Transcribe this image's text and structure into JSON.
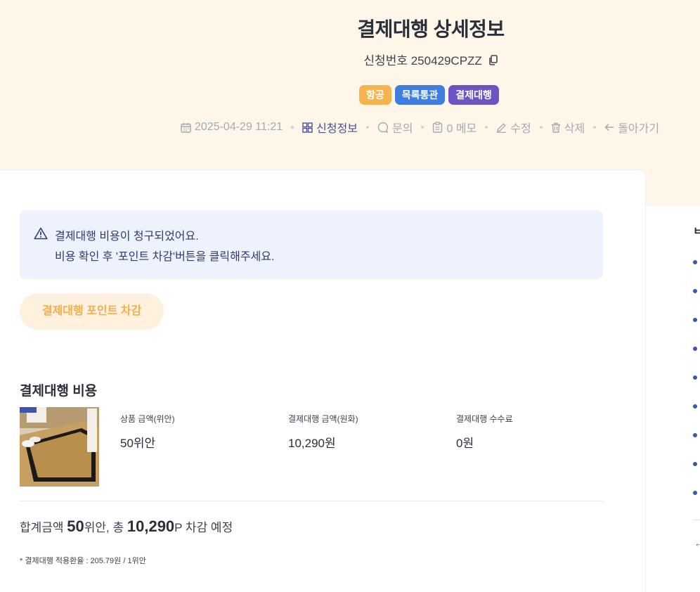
{
  "header": {
    "title": "결제대행 상세정보",
    "request_number": "신청번호 250429CPZZ",
    "badges": [
      "항공",
      "목록통관",
      "결제대행"
    ]
  },
  "meta": {
    "datetime": "2025-04-29 11:21",
    "apply_info": "신청정보",
    "inquiry": "문의",
    "memo": "0 메모",
    "edit": "수정",
    "delete": "삭제",
    "back": "돌아가기"
  },
  "alert": {
    "line1": "결제대행 비용이 청구되었어요.",
    "line2": "비용 확인 후 '포인트 차감'버튼을 클릭해주세요."
  },
  "deduct_button": "결제대행 포인트 차감",
  "cost": {
    "section_title": "결제대행 비용",
    "product_amount_label": "상품 금액(위안)",
    "product_amount_value": "50위안",
    "krw_amount_label": "결제대행 금액(원화)",
    "krw_amount_value": "10,290원",
    "fee_label": "결제대행 수수료",
    "fee_value": "0원",
    "total_prefix": "합계금액 ",
    "total_yuan": "50",
    "total_mid": "위안, 총 ",
    "total_points": "10,290",
    "total_suffix": "P 차감 예정",
    "rate_note": "* 결제대행 적용환율 : 205.79원 / 1위안"
  },
  "side_panel": {
    "heading": "ㅂ",
    "back_arrow": "←"
  },
  "colors": {
    "hero_bg": "#fff6ea",
    "badge_air": "#f7b44e",
    "badge_customs": "#3f7ee0",
    "badge_agency": "#6a55c2",
    "accent_orange": "#f5ae4e",
    "alert_bg": "#eef2fc"
  }
}
